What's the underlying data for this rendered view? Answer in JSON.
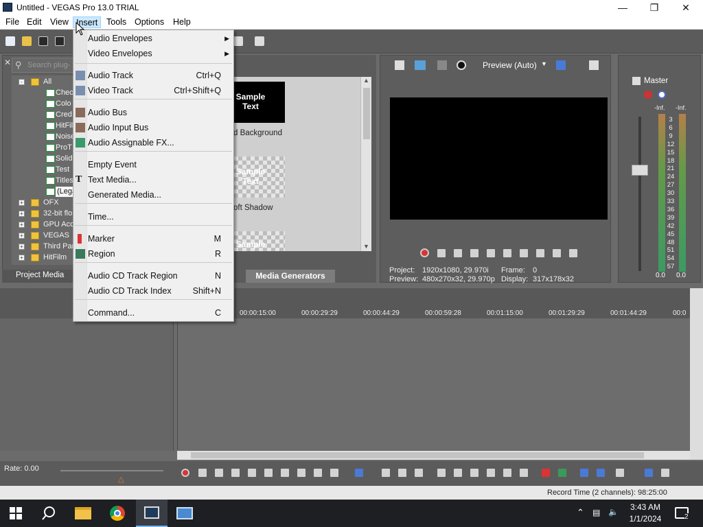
{
  "window": {
    "title": "Untitled - VEGAS Pro 13.0 TRIAL",
    "min_icon": "minimize-icon",
    "max_icon": "maximize-icon",
    "close_icon": "close-icon"
  },
  "menubar": {
    "items": [
      "File",
      "Edit",
      "View",
      "Insert",
      "Tools",
      "Options",
      "Help"
    ],
    "active": "Insert"
  },
  "insert_menu": {
    "items": [
      {
        "label": "Audio Envelopes",
        "shortcut": "",
        "submenu": true,
        "icon": ""
      },
      {
        "label": "Video Envelopes",
        "shortcut": "",
        "submenu": true,
        "icon": ""
      },
      {
        "label": "Audio Track",
        "shortcut": "Ctrl+Q",
        "submenu": false,
        "icon": "audio-track-icon"
      },
      {
        "label": "Video Track",
        "shortcut": "Ctrl+Shift+Q",
        "submenu": false,
        "icon": "video-track-icon"
      },
      {
        "label": "Audio Bus",
        "shortcut": "",
        "submenu": false,
        "icon": "audio-bus-icon"
      },
      {
        "label": "Audio Input Bus",
        "shortcut": "",
        "submenu": false,
        "icon": "audio-input-bus-icon"
      },
      {
        "label": "Audio Assignable FX...",
        "shortcut": "",
        "submenu": false,
        "icon": "assignable-fx-icon"
      },
      {
        "label": "Empty Event",
        "shortcut": "",
        "submenu": false,
        "icon": ""
      },
      {
        "label": "Text Media...",
        "shortcut": "",
        "submenu": false,
        "icon": "text-media-icon"
      },
      {
        "label": "Generated Media...",
        "shortcut": "",
        "submenu": false,
        "icon": ""
      },
      {
        "label": "Time...",
        "shortcut": "",
        "submenu": false,
        "icon": ""
      },
      {
        "label": "Marker",
        "shortcut": "M",
        "submenu": false,
        "icon": "marker-icon"
      },
      {
        "label": "Region",
        "shortcut": "R",
        "submenu": false,
        "icon": "region-icon"
      },
      {
        "label": "Audio CD Track Region",
        "shortcut": "N",
        "submenu": false,
        "icon": ""
      },
      {
        "label": "Audio CD Track Index",
        "shortcut": "Shift+N",
        "submenu": false,
        "icon": ""
      },
      {
        "label": "Command...",
        "shortcut": "C",
        "submenu": false,
        "icon": ""
      }
    ]
  },
  "plugin_browser": {
    "search_placeholder": "Search plug-",
    "tree": [
      {
        "label": "All",
        "kind": "folder",
        "expand": "-"
      },
      {
        "label": "Chec",
        "kind": "plugin"
      },
      {
        "label": "Colo",
        "kind": "plugin"
      },
      {
        "label": "Cred",
        "kind": "plugin"
      },
      {
        "label": "HitFil",
        "kind": "plugin"
      },
      {
        "label": "Noise",
        "kind": "plugin"
      },
      {
        "label": "ProT",
        "kind": "plugin"
      },
      {
        "label": "Solid",
        "kind": "plugin"
      },
      {
        "label": "Test",
        "kind": "plugin"
      },
      {
        "label": "Titles",
        "kind": "plugin"
      },
      {
        "label": "(Lega",
        "kind": "plugin"
      },
      {
        "label": "OFX",
        "kind": "folder",
        "expand": "+"
      },
      {
        "label": "32-bit flo",
        "kind": "folder",
        "expand": "+"
      },
      {
        "label": "GPU Acce",
        "kind": "folder",
        "expand": "+"
      },
      {
        "label": "VEGAS",
        "kind": "folder",
        "expand": "+"
      },
      {
        "label": "Third Par",
        "kind": "folder",
        "expand": "+"
      },
      {
        "label": "HitFilm",
        "kind": "folder",
        "expand": "+"
      }
    ],
    "tab": "Project Media"
  },
  "generators": {
    "presets": [
      {
        "thumb_text": "Sample Text",
        "caption": "d Background",
        "style": "solid"
      },
      {
        "thumb_text": "Sample Text",
        "caption": "oft Shadow",
        "style": "checker"
      },
      {
        "thumb_text": "Sample",
        "caption": "",
        "style": "checker"
      }
    ],
    "tab": "Media Generators"
  },
  "preview": {
    "mode": "Preview (Auto)",
    "project_label": "Project:",
    "project_value": "1920x1080, 29.970i",
    "preview_label": "Preview:",
    "preview_value": "480x270x32, 29.970p",
    "frame_label": "Frame:",
    "frame_value": "0",
    "display_label": "Display:",
    "display_value": "317x178x32"
  },
  "master": {
    "label": "Master",
    "inf_left": "-Inf.",
    "inf_right": "-Inf.",
    "scale": [
      "3",
      "6",
      "9",
      "12",
      "15",
      "18",
      "21",
      "24",
      "27",
      "30",
      "33",
      "36",
      "39",
      "42",
      "45",
      "48",
      "51",
      "54",
      "57"
    ],
    "level_left": "0.0",
    "level_right": "0.0"
  },
  "timeline": {
    "ruler": [
      "00:00:15:00",
      "00:00:29:29",
      "00:00:44:29",
      "00:00:59:28",
      "00:01:15:00",
      "00:01:29:29",
      "00:01:44:29",
      "00:0"
    ],
    "rate": "Rate: 0.00",
    "record_time": "Record Time (2 channels): 98:25:00"
  },
  "taskbar": {
    "time": "3:43 AM",
    "date": "1/1/2024",
    "notifications": "2"
  },
  "colors": {
    "menu_highlight": "#cce8ff",
    "panel_bg": "#5b5b5b",
    "taskbar": "#1e1f22"
  }
}
